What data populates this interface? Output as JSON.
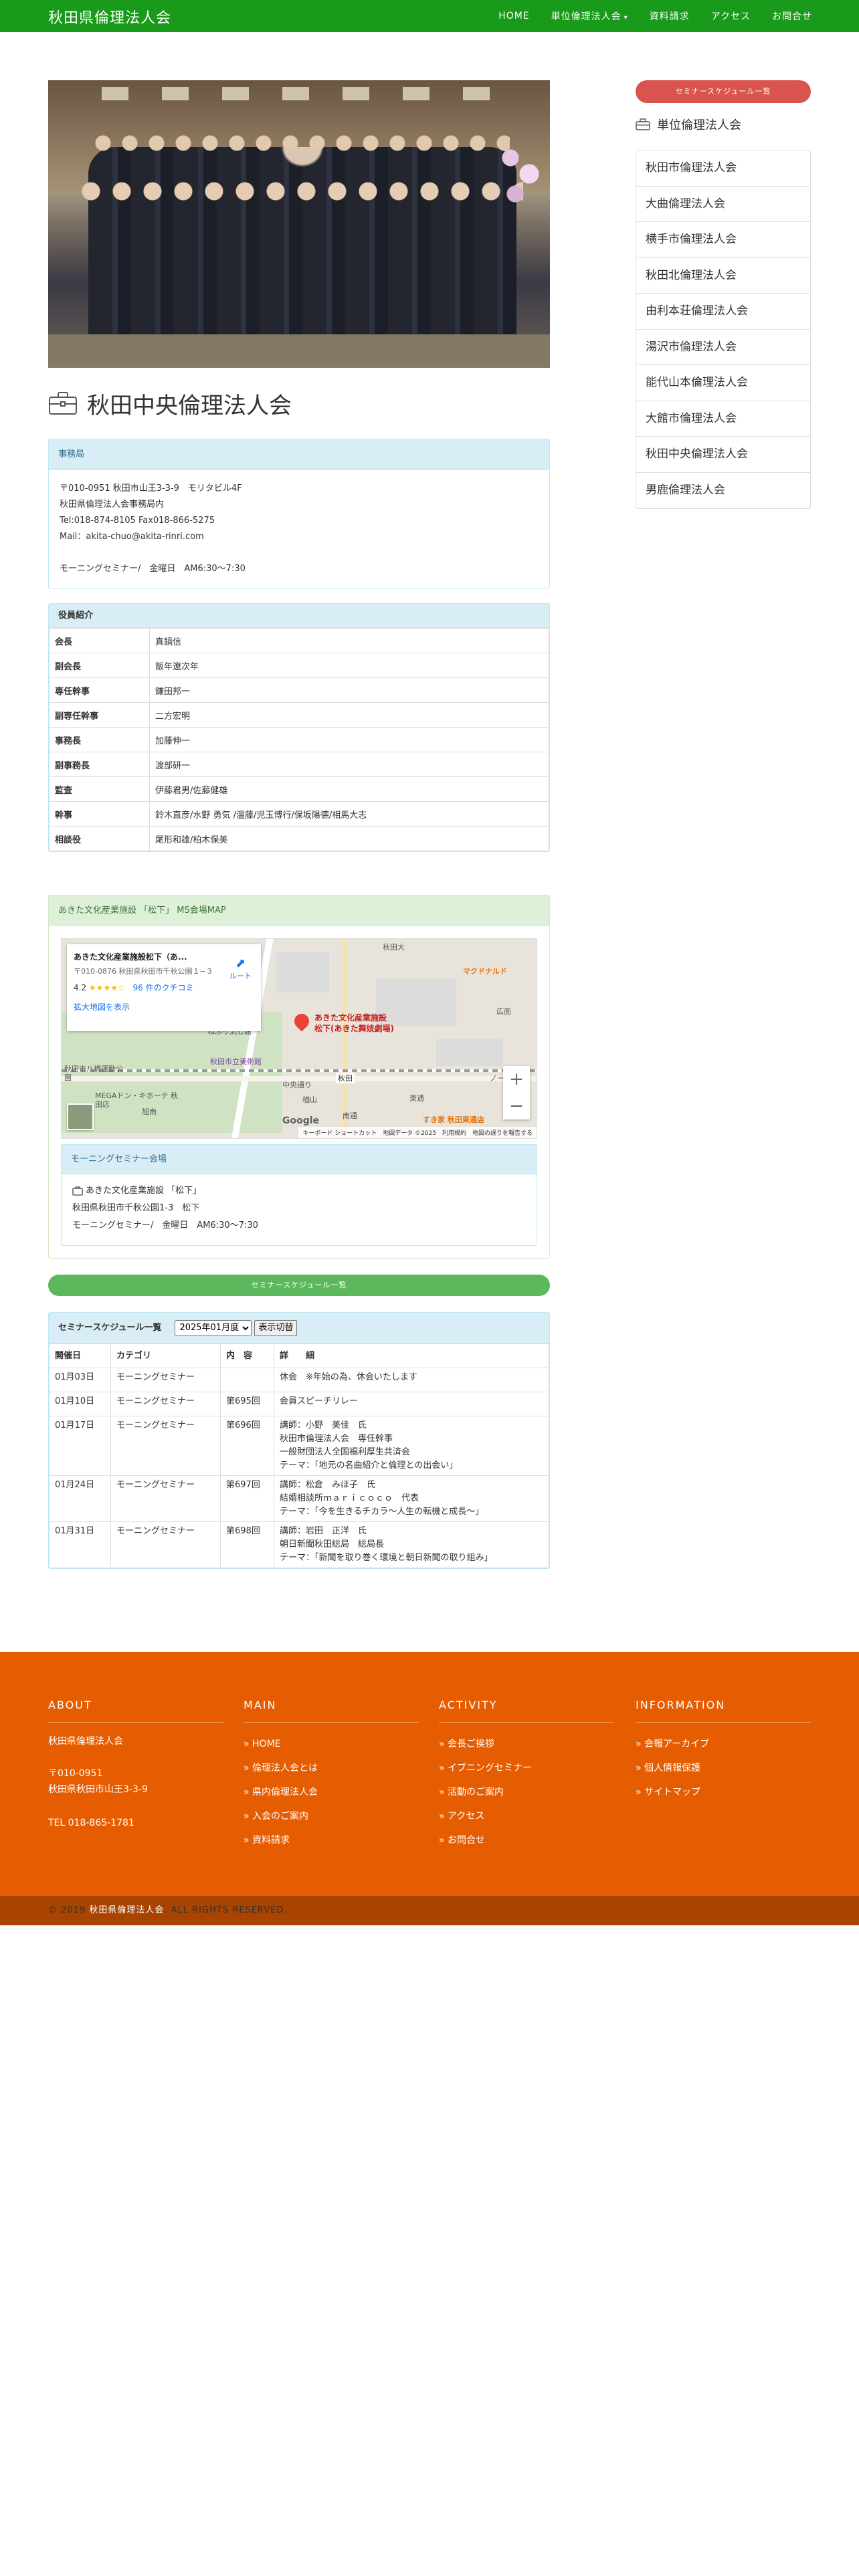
{
  "header": {
    "site_title": "秋田県倫理法人会",
    "nav": [
      {
        "label": "HOME"
      },
      {
        "label": "単位倫理法人会"
      },
      {
        "label": "資料請求"
      },
      {
        "label": "アクセス"
      },
      {
        "label": "お問合せ"
      }
    ]
  },
  "page": {
    "title": "秋田中央倫理法人会",
    "office": {
      "heading": "事務局",
      "lines": [
        "〒010-0951 秋田市山王3-3-9　モリタビル4F",
        "秋田県倫理法人会事務局内",
        "Tel:018-874-8105 Fax018-866-5275",
        "Mail：akita-chuo@akita-rinri.com",
        "",
        "モーニングセミナー/　金曜日　AM6:30〜7:30"
      ]
    },
    "officers": {
      "heading": "役員紹介",
      "rows": [
        {
          "role": "会長",
          "name": "真鍋信"
        },
        {
          "role": "副会長",
          "name": "飯年遼次年"
        },
        {
          "role": "専任幹事",
          "name": "鎌田邦一"
        },
        {
          "role": "副専任幹事",
          "name": "二方宏明"
        },
        {
          "role": "事務長",
          "name": "加藤伸一"
        },
        {
          "role": "副事務長",
          "name": "渡部研一"
        },
        {
          "role": "監査",
          "name": "伊藤君男/佐藤健雄"
        },
        {
          "role": "幹事",
          "name": "鈴木直彦/水野 勇気 /温藤/児玉博行/保坂陽德/相馬大志"
        },
        {
          "role": "相談役",
          "name": "尾形和雄/柏木保美"
        }
      ]
    },
    "map_section": {
      "heading": "あきた文化産業施設 「松下」 MS会場MAP",
      "card_title": "あきた文化産業施設松下（あ...",
      "card_address": "〒010-0876 秋田県秋田市千秋公園１−３",
      "rating": "4.2",
      "stars": "★★★★☆",
      "reviews": "96 件のクチコミ",
      "route": "ルート",
      "enlarge": "拡大地図を表示",
      "pin_label_1": "あきた文化産業施設",
      "pin_label_2": "松下(あきた舞妓劇場)",
      "labels": {
        "l1": "秋田大",
        "l2": "マクドナルド",
        "l3": "秋田市立美術館",
        "l4": "秋田市八橋運動公園",
        "l5": "MEGAドン・キホーテ 秋田店",
        "l6": "広面",
        "l7": "すき家 秋田東通店",
        "l8": "中央通り",
        "l9": "ねぶり流し館",
        "l10": "楢山",
        "l11": "東通",
        "l12": "秋田",
        "l13": "ノース",
        "l14": "南通",
        "l15": "旭南"
      },
      "google": "Google",
      "attribution": "キーボード ショートカット　地図データ ©2025　利用規約　地図の誤りを報告する",
      "zoom_in": "+",
      "zoom_out": "−"
    },
    "venue": {
      "heading": "モーニングセミナー会場",
      "name": "あきた文化産業施設 「松下」",
      "address": "秋田県秋田市千秋公園1-3　松下",
      "time": "モーニングセミナー/　金曜日　AM6:30〜7:30"
    },
    "schedule_button": "セミナースケジュール一覧",
    "schedule": {
      "heading": "セミナースケジュール一覧",
      "selected_year": "2025年01月度",
      "switch_button": "表示切替",
      "columns": [
        "開催日",
        "カテゴリ",
        "内　容",
        "詳　　細"
      ],
      "rows": [
        {
          "date": "01月03日",
          "category": "モーニングセミナー",
          "no": "",
          "detail": [
            "休会　※年始の為、休会いたします"
          ]
        },
        {
          "date": "01月10日",
          "category": "モーニングセミナー",
          "no": "第695回",
          "detail": [
            "会員スピーチリレー"
          ]
        },
        {
          "date": "01月17日",
          "category": "モーニングセミナー",
          "no": "第696回",
          "detail": [
            "講師：小野　美佳　氏",
            "秋田市倫理法人会　専任幹事",
            "一般財団法人全国福利厚生共済会",
            "テーマ：「地元の名曲紹介と倫理との出会い」"
          ]
        },
        {
          "date": "01月24日",
          "category": "モーニングセミナー",
          "no": "第697回",
          "detail": [
            "講師：松倉　みほ子　氏",
            "結婚相談所ｍａｒｉｃｏｃｏ　代表",
            "テーマ：「今を生きるチカラ〜人生の転機と成長〜」"
          ]
        },
        {
          "date": "01月31日",
          "category": "モーニングセミナー",
          "no": "第698回",
          "detail": [
            "講師：岩田　正洋　氏",
            "朝日新聞秋田総局　総局長",
            "テーマ：「新聞を取り巻く環境と朝日新聞の取り組み」"
          ]
        }
      ]
    }
  },
  "sidebar": {
    "schedule_button": "セミナースケジュール一覧",
    "heading": "単位倫理法人会",
    "items": [
      "秋田市倫理法人会",
      "大曲倫理法人会",
      "横手市倫理法人会",
      "秋田北倫理法人会",
      "由利本荘倫理法人会",
      "湯沢市倫理法人会",
      "能代山本倫理法人会",
      "大館市倫理法人会",
      "秋田中央倫理法人会",
      "男鹿倫理法人会"
    ]
  },
  "footer": {
    "about": {
      "heading": "ABOUT",
      "name": "秋田県倫理法人会",
      "zip": "〒010-0951",
      "address": "秋田県秋田市山王3-3-9",
      "tel": "TEL 018-865-1781"
    },
    "main": {
      "heading": "MAIN",
      "links": [
        "HOME",
        "倫理法人会とは",
        "県内倫理法人会",
        "入会のご案内",
        "資料請求"
      ]
    },
    "activity": {
      "heading": "ACTIVITY",
      "links": [
        "会長ご挨拶",
        "イブニングセミナー",
        "活動のご案内",
        "アクセス",
        "お問合せ"
      ]
    },
    "information": {
      "heading": "INFORMATION",
      "links": [
        "会報アーカイブ",
        "個人情報保護",
        "サイトマップ"
      ]
    },
    "copyright_prefix": "© 2019",
    "copyright_name": "秋田県倫理法人会",
    "copyright_suffix": ". ALL RIGHTS RESERVED."
  },
  "colors": {
    "header_green": "#1a9a1a",
    "footer_orange": "#e65c00",
    "copyright_bar": "#a84300",
    "button_red": "#d9534f",
    "button_green": "#5cb85c",
    "panel_blue": "#d9edf7",
    "panel_green": "#dff0d8"
  },
  "icons": {
    "title": "briefcase-icon",
    "sidebar": "briefcase-icon",
    "venue": "building-icon"
  }
}
